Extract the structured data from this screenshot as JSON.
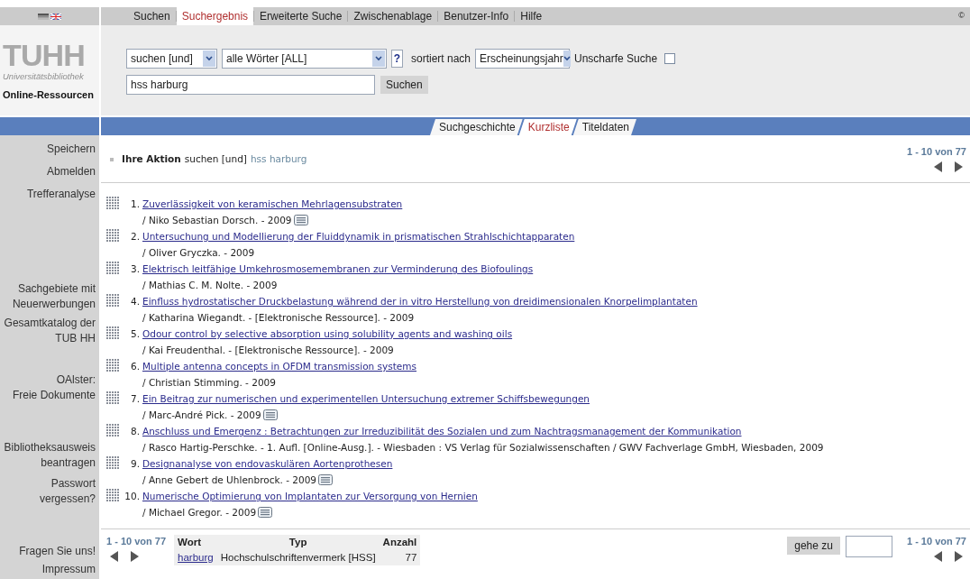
{
  "nav": {
    "items": [
      {
        "label": "Suchen",
        "selected": false
      },
      {
        "label": "Suchergebnis",
        "selected": true
      },
      {
        "label": "Erweiterte Suche",
        "selected": false
      },
      {
        "label": "Zwischenablage",
        "selected": false
      },
      {
        "label": "Benutzer-Info",
        "selected": false
      },
      {
        "label": "Hilfe",
        "selected": false
      }
    ],
    "copyright": "©"
  },
  "logo": {
    "mark": "TUHH",
    "subtitle": "Universitätsbibliothek",
    "name": "Online-Ressourcen"
  },
  "search": {
    "operator": "suchen [und]",
    "field": "alle Wörter [ALL]",
    "help": "?",
    "sort_label": "sortiert nach",
    "sort": "Erscheinungsjahr",
    "fuzzy_label": "Unscharfe Suche",
    "fuzzy_checked": false,
    "query": "hss harburg",
    "submit": "Suchen"
  },
  "view_tabs": [
    {
      "label": "Suchgeschichte",
      "selected": false
    },
    {
      "label": "Kurzliste",
      "selected": true
    },
    {
      "label": "Titeldaten",
      "selected": false
    }
  ],
  "sidebar": {
    "items": [
      "Speichern",
      "Abmelden",
      "Trefferanalyse",
      "Sachgebiete mit\nNeuerwerbungen",
      "Gesamtkatalog der\nTUB HH",
      "OAlster:\nFreie Dokumente",
      "Bibliotheksausweis\nbeantragen",
      "Passwort\nvergessen?",
      "Fragen Sie uns!",
      "Impressum"
    ]
  },
  "action": {
    "label": "Ihre Aktion",
    "operator": "suchen [und]",
    "query": "hss harburg"
  },
  "top_pager": "1 - 10 von 77",
  "results": [
    {
      "number": "1.",
      "title": "Zuverlässigkeit von keramischen Mehrlagensubstraten",
      "byline": "/ Niko Sebastian Dorsch. - 2009",
      "fulltext": true
    },
    {
      "number": "2.",
      "title": "Untersuchung und Modellierung der Fluiddynamik in prismatischen Strahlschichtapparaten",
      "byline": "/ Oliver Gryczka. - 2009",
      "fulltext": false
    },
    {
      "number": "3.",
      "title": "Elektrisch leitfähige Umkehrosmosemembranen zur Verminderung des Biofoulings",
      "byline": "/ Mathias C. M. Nolte. - 2009",
      "fulltext": false
    },
    {
      "number": "4.",
      "title": "Einfluss hydrostatischer Druckbelastung während der in vitro Herstellung von dreidimensionalen Knorpelimplantaten",
      "byline": "/ Katharina Wiegandt. - [Elektronische Ressource]. - 2009",
      "fulltext": false
    },
    {
      "number": "5.",
      "title": "Odour control by selective absorption using solubility agents and washing oils",
      "byline": "/ Kai Freudenthal. - [Elektronische Ressource]. - 2009",
      "fulltext": false
    },
    {
      "number": "6.",
      "title": "Multiple antenna concepts in OFDM transmission systems",
      "byline": "/ Christian Stimming. - 2009",
      "fulltext": false
    },
    {
      "number": "7.",
      "title": "Ein Beitrag zur numerischen und experimentellen Untersuchung extremer Schiffsbewegungen",
      "byline": "/ Marc-André Pick. - 2009",
      "fulltext": true
    },
    {
      "number": "8.",
      "title": "Anschluss und Emergenz : Betrachtungen zur Irreduzibilität des Sozialen und zum Nachtragsmanagement der Kommunikation",
      "byline": "/ Rasco Hartig-Perschke. - 1. Aufl. [Online-Ausg.]. - Wiesbaden : VS Verlag für Sozialwissenschaften / GWV Fachverlage GmbH, Wiesbaden, 2009",
      "fulltext": false
    },
    {
      "number": "9.",
      "title": "Designanalyse von endovaskulären Aortenprothesen",
      "byline": "/ Anne Gebert de Uhlenbrock. - 2009",
      "fulltext": true
    },
    {
      "number": "10.",
      "title": "Numerische Optimierung von Implantaten zur Versorgung von Hernien",
      "byline": "/ Michael Gregor. - 2009",
      "fulltext": true
    }
  ],
  "bottom_left_pager": "1 - 10 von 77",
  "terms_table": {
    "columns": [
      "Wort",
      "Typ",
      "Anzahl"
    ],
    "rows": [
      [
        "harburg",
        "Hochschulschriftenvermerk [HSS]",
        "77"
      ]
    ]
  },
  "goto": {
    "button": "gehe zu"
  },
  "bottom_right_pager": "1 - 10 von 77"
}
